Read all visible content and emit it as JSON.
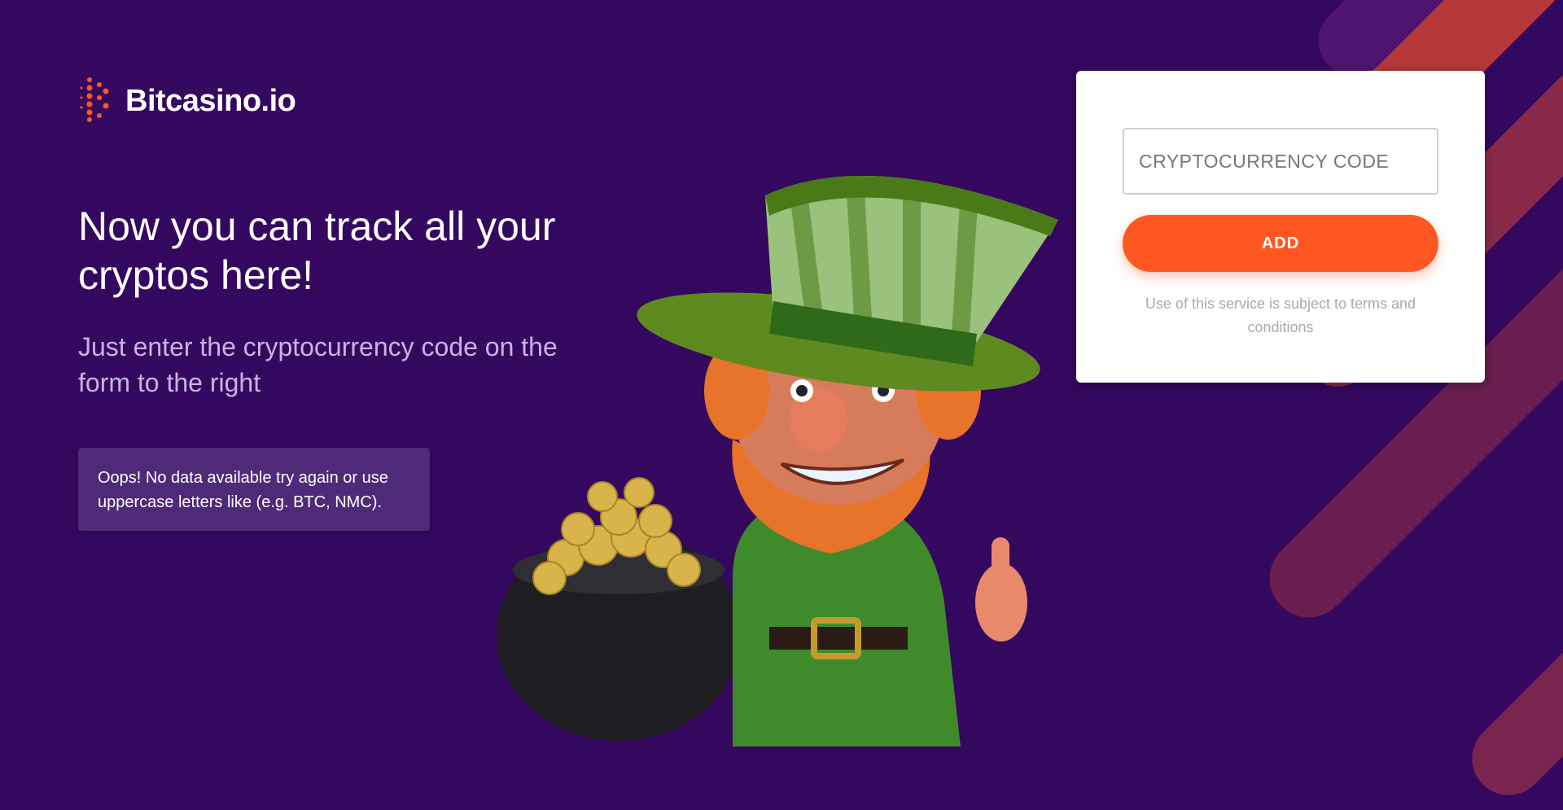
{
  "brand": {
    "name": "Bitcasino.io",
    "logo_icon": "dotted-b-icon",
    "accent": "#ff5722"
  },
  "hero": {
    "headline": "Now you can track all your cryptos here!",
    "subtext": "Just enter the cryptocurrency code on the form to the right"
  },
  "alert": {
    "message": "Oops! No data available try again or use uppercase letters like (e.g. BTC, NMC)."
  },
  "form": {
    "code_input": {
      "placeholder": "CRYPTOCURRENCY CODE",
      "value": ""
    },
    "add_label": "ADD",
    "terms": "Use of this service is subject to terms and conditions"
  },
  "colors": {
    "background": "#350860",
    "alert_bg": "#4f2a78",
    "stripe": "#b5383a",
    "button": "#ff5722"
  },
  "mascot": {
    "icon": "leprechaun-with-gold-pot-icon"
  }
}
